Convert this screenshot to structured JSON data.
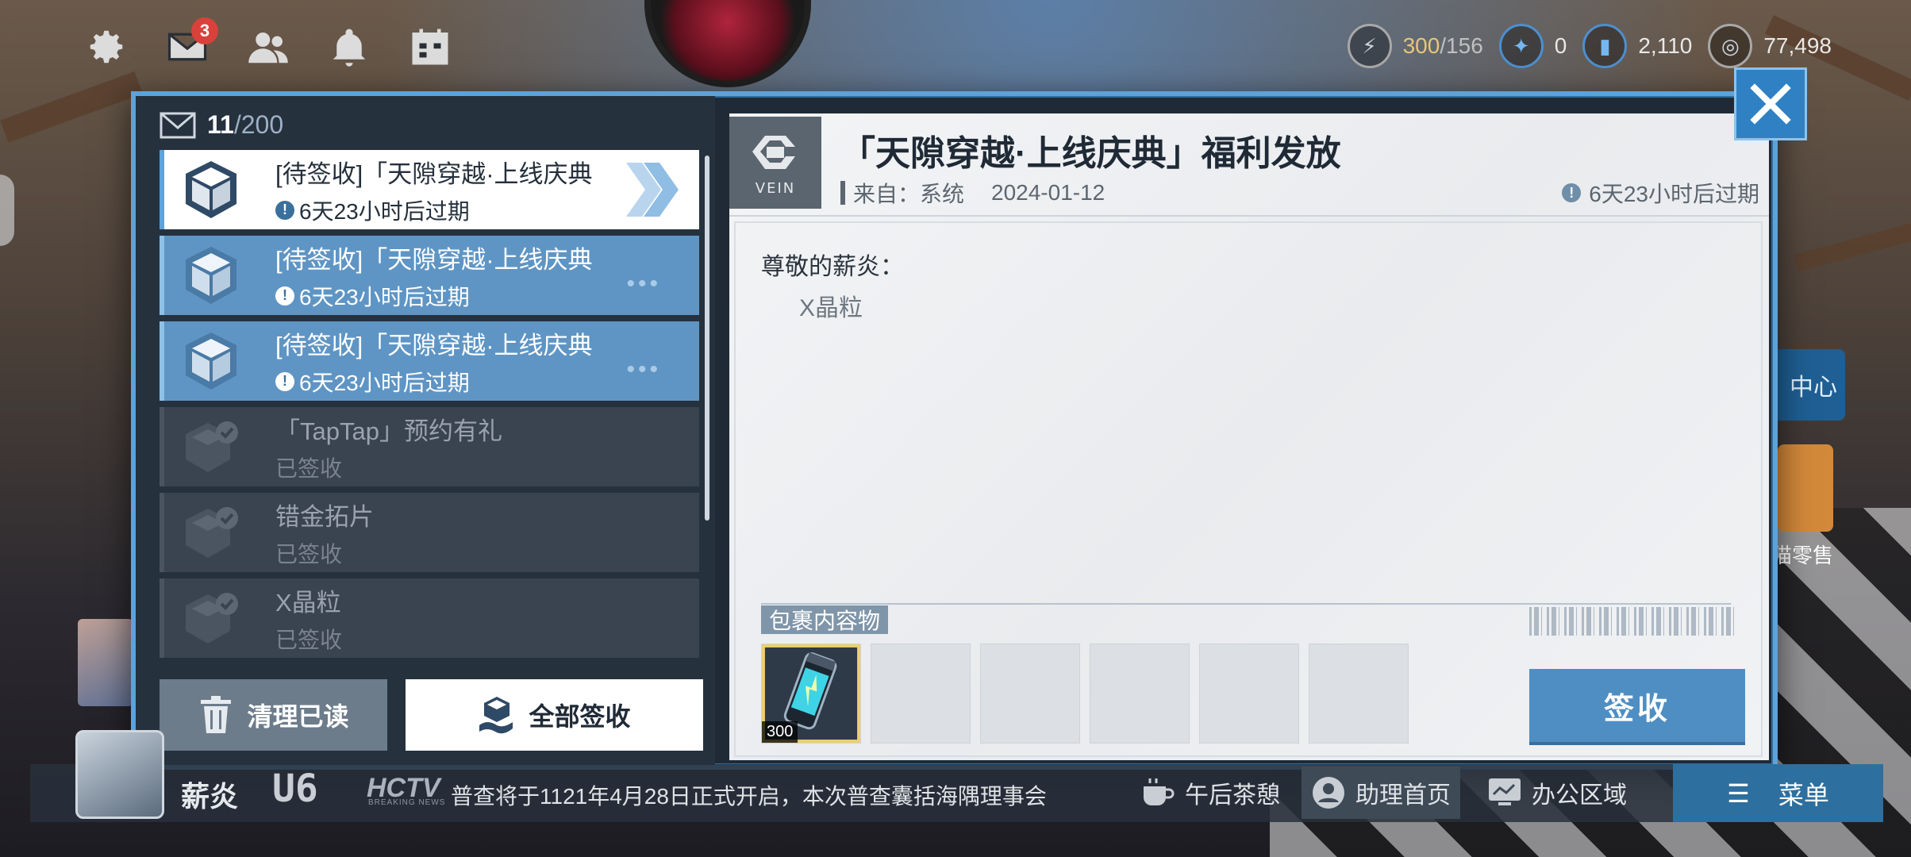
{
  "top_icons": [
    {
      "name": "settings-gear-icon",
      "badge": null
    },
    {
      "name": "mail-icon",
      "badge": "3"
    },
    {
      "name": "friends-icon",
      "badge": null
    },
    {
      "name": "notification-bell-icon",
      "badge": null
    },
    {
      "name": "calendar-icon",
      "badge": null
    }
  ],
  "resources": {
    "stamina": {
      "current": "300",
      "max": "/156"
    },
    "crystal": "0",
    "currency_a": "2,110",
    "currency_b": "77,498"
  },
  "mail_count": {
    "current": "11",
    "max": "/200"
  },
  "mail_list": [
    {
      "title": "[待签收]「天隙穿越·上线庆典",
      "subtitle": "6天23小时后过期",
      "state": "active"
    },
    {
      "title": "[待签收]「天隙穿越·上线庆典",
      "subtitle": "6天23小时后过期",
      "state": "unread"
    },
    {
      "title": "[待签收]「天隙穿越·上线庆典",
      "subtitle": "6天23小时后过期",
      "state": "unread"
    },
    {
      "title": "「TapTap」预约有礼",
      "subtitle": "已签收",
      "state": "read"
    },
    {
      "title": "错金拓片",
      "subtitle": "已签收",
      "state": "read"
    },
    {
      "title": "X晶粒",
      "subtitle": "已签收",
      "state": "read"
    }
  ],
  "buttons": {
    "clear_read": "清理已读",
    "sign_all": "全部签收",
    "sign": "签收"
  },
  "detail": {
    "logo_text": "VEIN",
    "title": "「天隙穿越·上线庆典」福利发放",
    "from_label": "来自：系统",
    "date": "2024-01-12",
    "expire": "6天23小时后过期",
    "greeting": "尊敬的薪炎：",
    "body": "X晶粒",
    "package_label": "包裹内容物",
    "attachments": [
      {
        "name": "X晶粒",
        "quantity": "300"
      }
    ]
  },
  "bottom_bar": {
    "player_name": "薪炎",
    "player_level": "U6",
    "channel": "HCTV",
    "channel_sub": "BREAKING NEWS",
    "news": "普查将于1121年4月28日正式开启，本次普查囊括海隅理事会",
    "afternoon_tea": "午后茶憩",
    "assistant_home": "助理首页",
    "office_area": "办公区域",
    "menu": "菜单"
  },
  "side_labels": {
    "center_btn": "中心",
    "retail": "猫零售"
  },
  "colors": {
    "accent_blue": "#5ea2d8",
    "unread_item": "#5f95c4",
    "sign_button": "#4f8ec3",
    "mail_badge": "#d9413b"
  }
}
